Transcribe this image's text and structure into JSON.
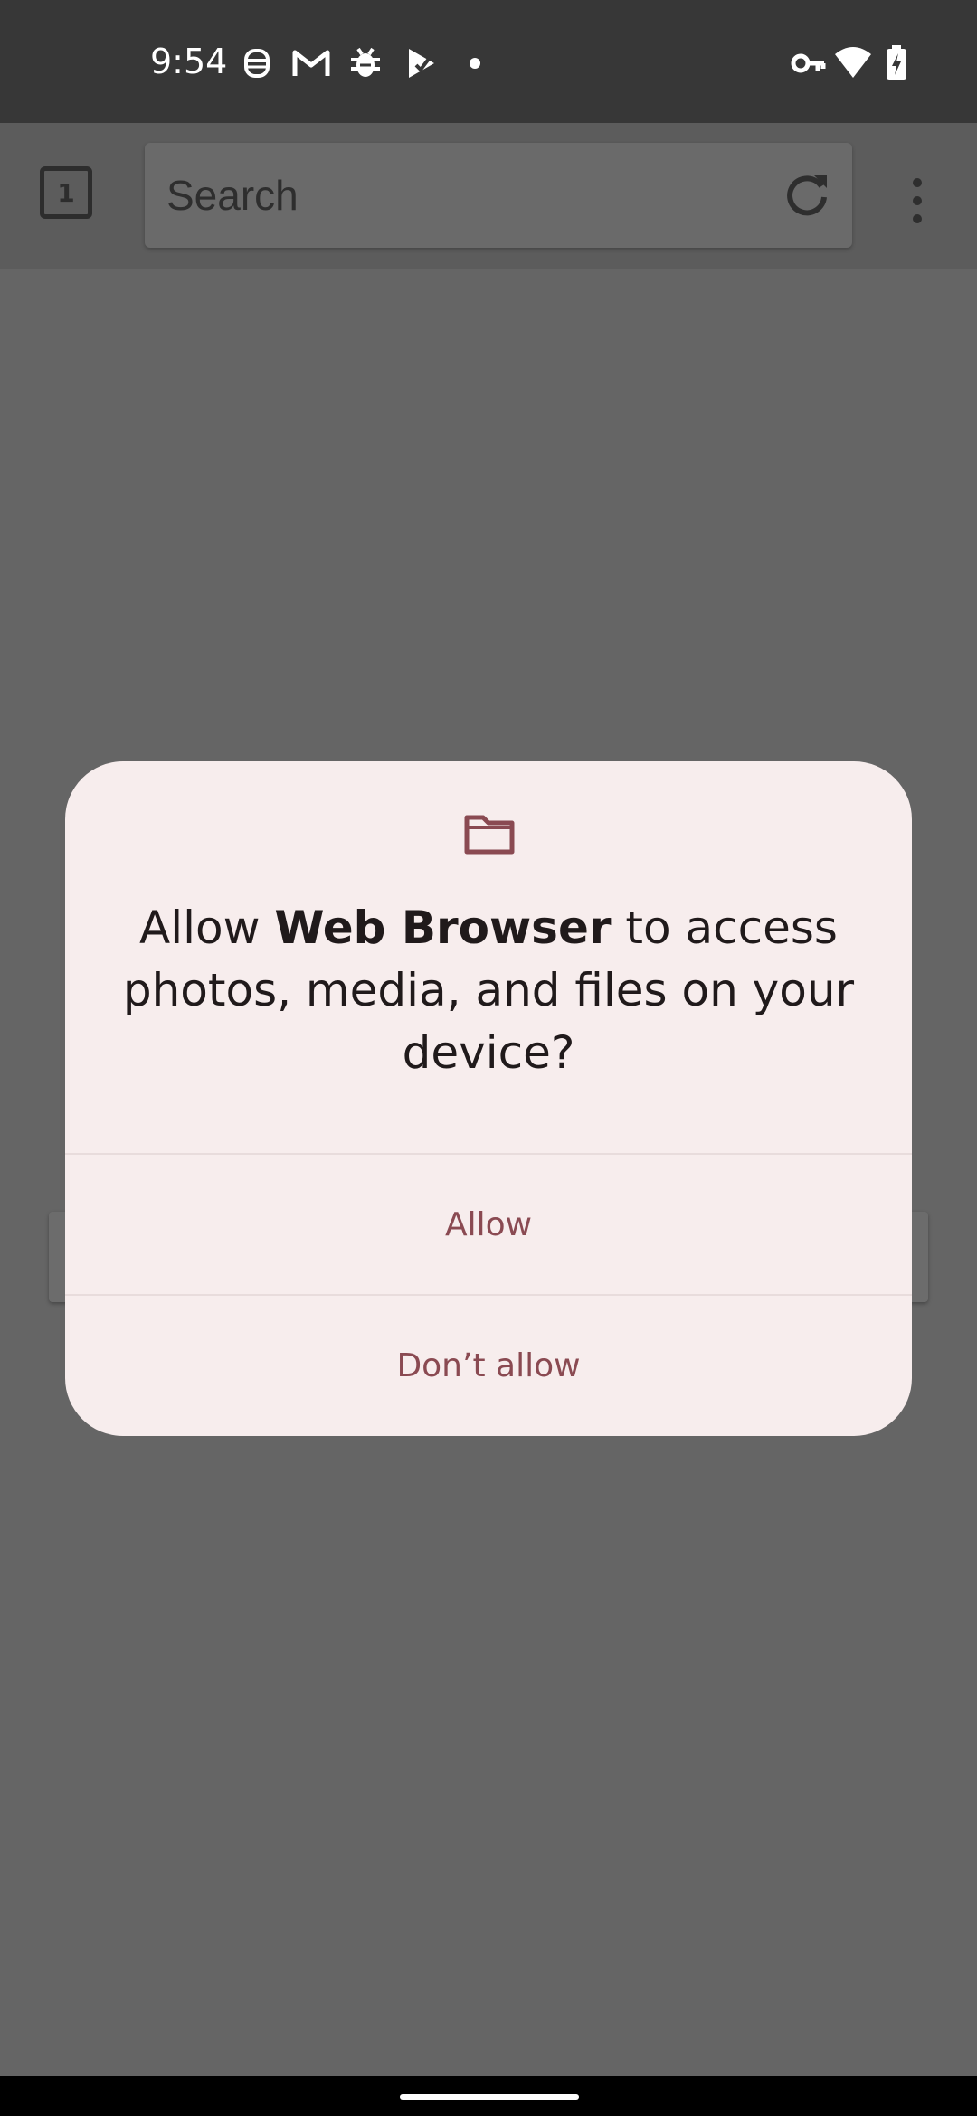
{
  "status_bar": {
    "time": "9:54",
    "left_icons": [
      "lab-icon",
      "gmail-icon",
      "bug-icon",
      "play-protect-icon",
      "dot-icon"
    ],
    "right_icons": [
      "vpn-key-icon",
      "wifi-icon",
      "battery-charging-icon"
    ]
  },
  "toolbar": {
    "tab_count": "1",
    "search_placeholder": "Search",
    "refresh_icon": "refresh-icon",
    "menu_icon": "overflow-menu-icon"
  },
  "dialog": {
    "icon": "folder-icon",
    "title_prefix": "Allow ",
    "app_name": "Web Browser",
    "title_suffix": " to access photos, media, and files on your device?",
    "allow_label": "Allow",
    "deny_label": "Don’t allow"
  },
  "colors": {
    "accent": "#8a4a52",
    "dialog_bg": "#f7eded",
    "scrim": "#656565"
  }
}
